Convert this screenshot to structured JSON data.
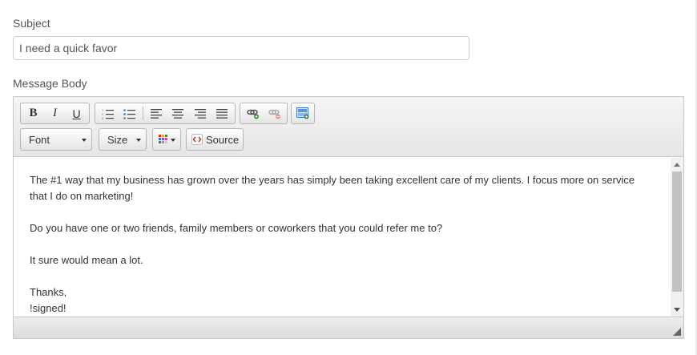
{
  "form": {
    "subject_label": "Subject",
    "subject_value": "I need a quick favor",
    "body_label": "Message Body"
  },
  "toolbar": {
    "bold": "B",
    "italic": "I",
    "underline": "U",
    "font_label": "Font",
    "size_label": "Size",
    "source_label": "Source",
    "icons": [
      "numbered-list-icon",
      "bulleted-list-icon",
      "align-left-icon",
      "align-center-icon",
      "align-right-icon",
      "align-justify-icon",
      "link-icon",
      "unlink-icon",
      "insert-image-icon",
      "text-color-icon",
      "source-icon"
    ]
  },
  "body": {
    "paragraphs": [
      "The #1 way that my business has grown over the years has simply been taking excellent care of my clients. I focus more on service that I do on marketing!",
      "Do you have one or two friends, family members or coworkers that you could refer me to?",
      "It sure would mean a lot.",
      "Thanks,",
      "!signed!"
    ]
  },
  "colors": {
    "accent_blue": "#3a78c4",
    "link_green": "#3a8a3a",
    "source_red": "#d0342c"
  }
}
